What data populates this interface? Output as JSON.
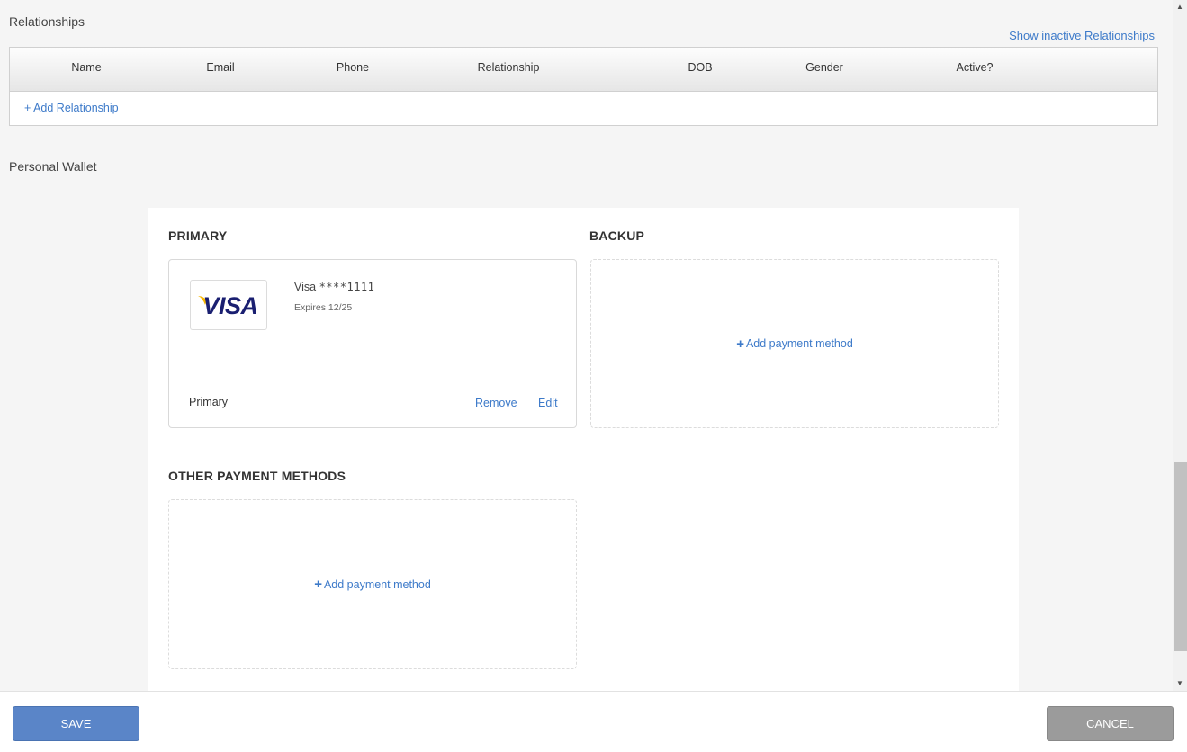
{
  "relationships": {
    "title": "Relationships",
    "show_inactive": "Show inactive Relationships",
    "columns": [
      "Name",
      "Email",
      "Phone",
      "Relationship",
      "DOB",
      "Gender",
      "Active?"
    ],
    "add_label": "+ Add Relationship"
  },
  "wallet": {
    "title": "Personal Wallet",
    "primary_heading": "PRIMARY",
    "backup_heading": "BACKUP",
    "other_heading": "OTHER PAYMENT METHODS",
    "primary_card": {
      "brand": "Visa",
      "logo_text": "VISA",
      "number": "****1111",
      "expires": "Expires 12/25",
      "status": "Primary",
      "remove_label": "Remove",
      "edit_label": "Edit"
    },
    "add_payment_label": "Add payment method"
  },
  "scrollbar": {
    "up_glyph": "▲",
    "down_glyph": "▼"
  },
  "footer": {
    "save_label": "SAVE",
    "cancel_label": "CANCEL"
  },
  "colors": {
    "link": "#3d7ac9",
    "save_button": "#5a85c8",
    "cancel_button": "#9b9b9b",
    "visa_blue": "#1a1f71",
    "visa_gold": "#f7b600"
  }
}
